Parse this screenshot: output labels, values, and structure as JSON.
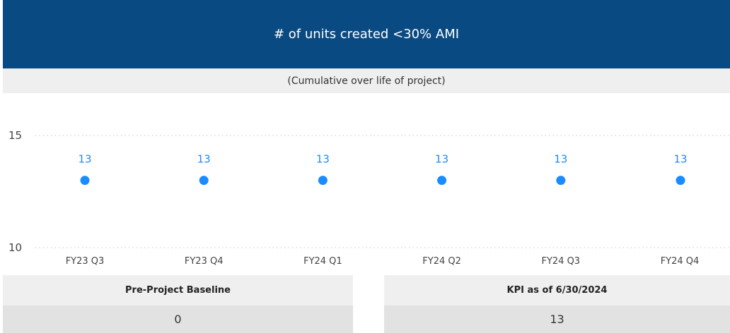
{
  "header": {
    "title": "# of units created <30% AMI",
    "subtitle": "(Cumulative over life of project)"
  },
  "colors": {
    "header_bg": "#0a4a82",
    "marker": "#1a8cff",
    "panel_bg": "#efefef"
  },
  "chart_data": {
    "type": "scatter",
    "categories": [
      "FY23 Q3",
      "FY23 Q4",
      "FY24 Q1",
      "FY24 Q2",
      "FY24 Q3",
      "FY24 Q4"
    ],
    "values": [
      13,
      13,
      13,
      13,
      13,
      13
    ],
    "data_labels": [
      "13",
      "13",
      "13",
      "13",
      "13",
      "13"
    ],
    "ylim": [
      10,
      15
    ],
    "yticks": [
      10,
      15
    ],
    "grid": "dotted horizontal at ticks",
    "legend": "none",
    "title": "",
    "xlabel": "",
    "ylabel": ""
  },
  "kpis": {
    "baseline": {
      "label": "Pre-Project Baseline",
      "value": "0"
    },
    "current": {
      "label": "KPI as of 6/30/2024",
      "value": "13"
    }
  }
}
